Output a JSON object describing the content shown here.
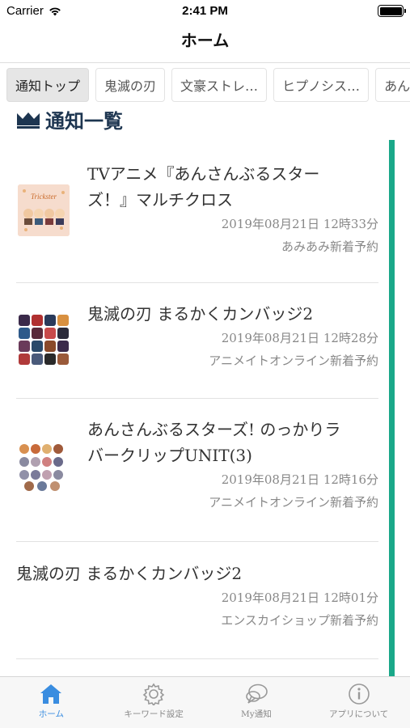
{
  "status": {
    "carrier": "Carrier",
    "time": "2:41 PM"
  },
  "nav": {
    "title": "ホーム"
  },
  "tabs": [
    "通知トップ",
    "鬼滅の刃",
    "文豪ストレ…",
    "ヒプノシス…",
    "あん"
  ],
  "section": {
    "title": "通知一覧"
  },
  "colors": {
    "accent": "#1aa889",
    "tab_active": "#3a8de0"
  },
  "notifications": [
    {
      "title_line1": "TVアニメ『あんさんぶるスター",
      "title_line2": "ズ！』マルチクロス",
      "date": "2019年08月21日 12時33分",
      "source": "あみあみ新着予約",
      "thumb_text": "Trickster"
    },
    {
      "title_line1": "鬼滅の刃 まるかくカンバッジ2",
      "date": "2019年08月21日 12時28分",
      "source": "アニメイトオンライン新着予約"
    },
    {
      "title_line1": "あんさんぶるスターズ! のっかりラ",
      "title_line2": "バークリップUNIT(3)",
      "date": "2019年08月21日 12時16分",
      "source": "アニメイトオンライン新着予約"
    },
    {
      "title_line1": "鬼滅の刃 まるかくカンバッジ2",
      "date": "2019年08月21日 12時01分",
      "source": "エンスカイショップ新着予約"
    }
  ],
  "tabbar": [
    {
      "label": "ホーム",
      "icon": "home-icon"
    },
    {
      "label": "キーワード設定",
      "icon": "gear-icon"
    },
    {
      "label": "My通知",
      "icon": "chat-icon"
    },
    {
      "label": "アプリについて",
      "icon": "info-icon"
    }
  ]
}
